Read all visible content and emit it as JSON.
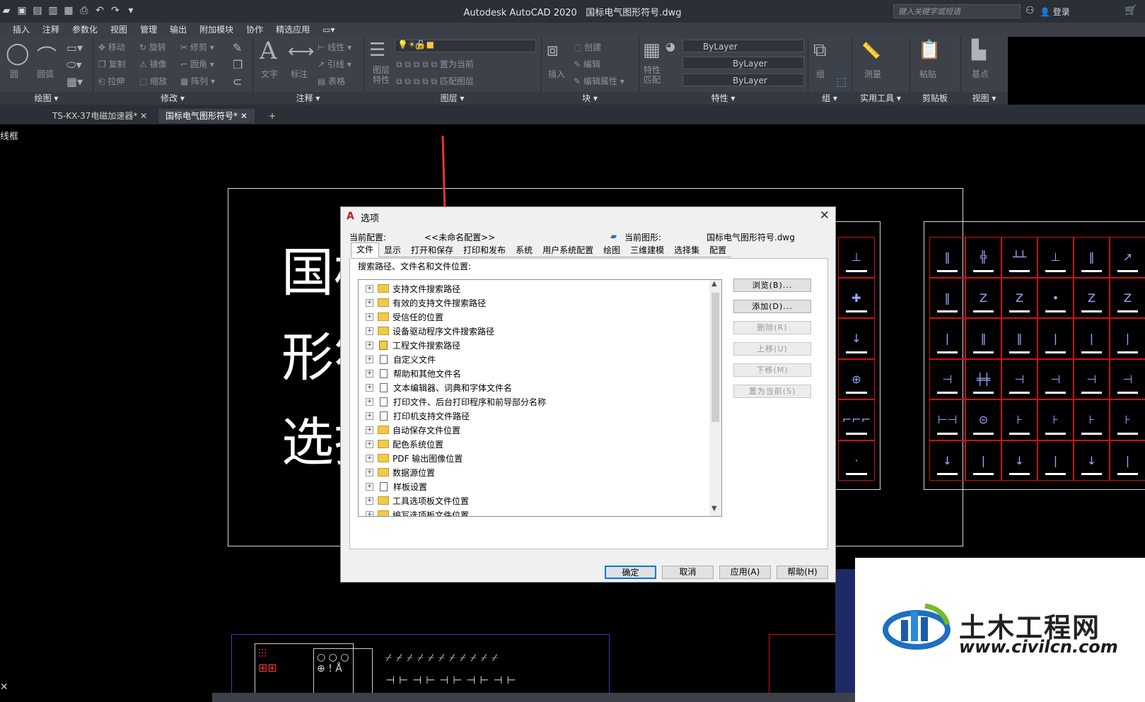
{
  "app": {
    "title": "Autodesk AutoCAD 2020",
    "drawing_name": "国标电气图形符号.dwg",
    "search_placeholder": "键入关键字或短语",
    "login": "登录"
  },
  "menu": [
    "插入",
    "注释",
    "参数化",
    "视图",
    "管理",
    "输出",
    "附加模块",
    "协作",
    "精选应用"
  ],
  "ribbon": {
    "panels": [
      {
        "label": "绘图 ▾",
        "items": [
          "圆",
          "圆弧"
        ]
      },
      {
        "label": "修改 ▾",
        "items": [
          "移动",
          "旋转",
          "修剪",
          "复制",
          "镜像",
          "圆角",
          "拉伸",
          "缩放",
          "阵列"
        ]
      },
      {
        "label": "注释 ▾",
        "items": [
          "文字",
          "标注",
          "线性",
          "引线",
          "表格"
        ]
      },
      {
        "label": "图层 ▾",
        "items": [
          "图层特性",
          "置为当前",
          "匹配图层"
        ],
        "layer": "0"
      },
      {
        "label": "块 ▾",
        "items": [
          "插入",
          "创建",
          "编辑",
          "编辑属性"
        ]
      },
      {
        "label": "特性 ▾",
        "items": [
          "特性匹配"
        ],
        "combos": [
          "ByLayer",
          "ByLayer",
          "ByLayer"
        ]
      },
      {
        "label": "组 ▾",
        "items": [
          "组"
        ]
      },
      {
        "label": "实用工具 ▾",
        "items": [
          "测量"
        ]
      },
      {
        "label": "剪贴板",
        "items": [
          "粘贴"
        ]
      },
      {
        "label": "视图 ▾",
        "items": [
          "基点"
        ]
      }
    ]
  },
  "doc_tabs": [
    "TS-KX-37电磁加速器* ✕",
    "国标电气图形符号* ✕",
    "+"
  ],
  "viewport_label": "线框",
  "drawing_text": [
    "国标",
    "形符",
    "选择"
  ],
  "dialog": {
    "title": "选项",
    "current_profile_label": "当前配置:",
    "current_profile": "<<未命名配置>>",
    "current_drawing_label": "当前图形:",
    "current_drawing": "国标电气图形符号.dwg",
    "tabs": [
      "文件",
      "显示",
      "打开和保存",
      "打印和发布",
      "系统",
      "用户系统配置",
      "绘图",
      "三维建模",
      "选择集",
      "配置"
    ],
    "section_label": "搜索路径、文件名和文件位置:",
    "tree_items": [
      {
        "text": "支持文件搜索路径",
        "icon": "folder"
      },
      {
        "text": "有效的支持文件搜索路径",
        "icon": "folder"
      },
      {
        "text": "受信任的位置",
        "icon": "folder"
      },
      {
        "text": "设备驱动程序文件搜索路径",
        "icon": "folder"
      },
      {
        "text": "工程文件搜索路径",
        "icon": "project"
      },
      {
        "text": "自定义文件",
        "icon": "doc"
      },
      {
        "text": "帮助和其他文件名",
        "icon": "doc"
      },
      {
        "text": "文本编辑器、词典和字体文件名",
        "icon": "doc"
      },
      {
        "text": "打印文件、后台打印程序和前导部分名称",
        "icon": "doc"
      },
      {
        "text": "打印机支持文件路径",
        "icon": "doc"
      },
      {
        "text": "自动保存文件位置",
        "icon": "folder"
      },
      {
        "text": "配色系统位置",
        "icon": "folder"
      },
      {
        "text": "PDF 输出图像位置",
        "icon": "folder"
      },
      {
        "text": "数据源位置",
        "icon": "folder"
      },
      {
        "text": "样板设置",
        "icon": "doc"
      },
      {
        "text": "工具选项板文件位置",
        "icon": "folder"
      },
      {
        "text": "编写选项板文件位置",
        "icon": "folder"
      }
    ],
    "side_buttons": [
      "浏览(B)...",
      "添加(D)...",
      "删除(R)",
      "上移(U)",
      "下移(M)",
      "置为当前(S)"
    ],
    "footer_buttons": [
      "确定",
      "取消",
      "应用(A)",
      "帮助(H)"
    ]
  },
  "watermark": {
    "brand": "土木工程网",
    "url": "www.civilcn.com"
  },
  "colors": {
    "canvas": "#000000",
    "ribbon": "#3c414a",
    "accent_red": "#e8382e",
    "dialog_bg": "#f0f0f0"
  }
}
